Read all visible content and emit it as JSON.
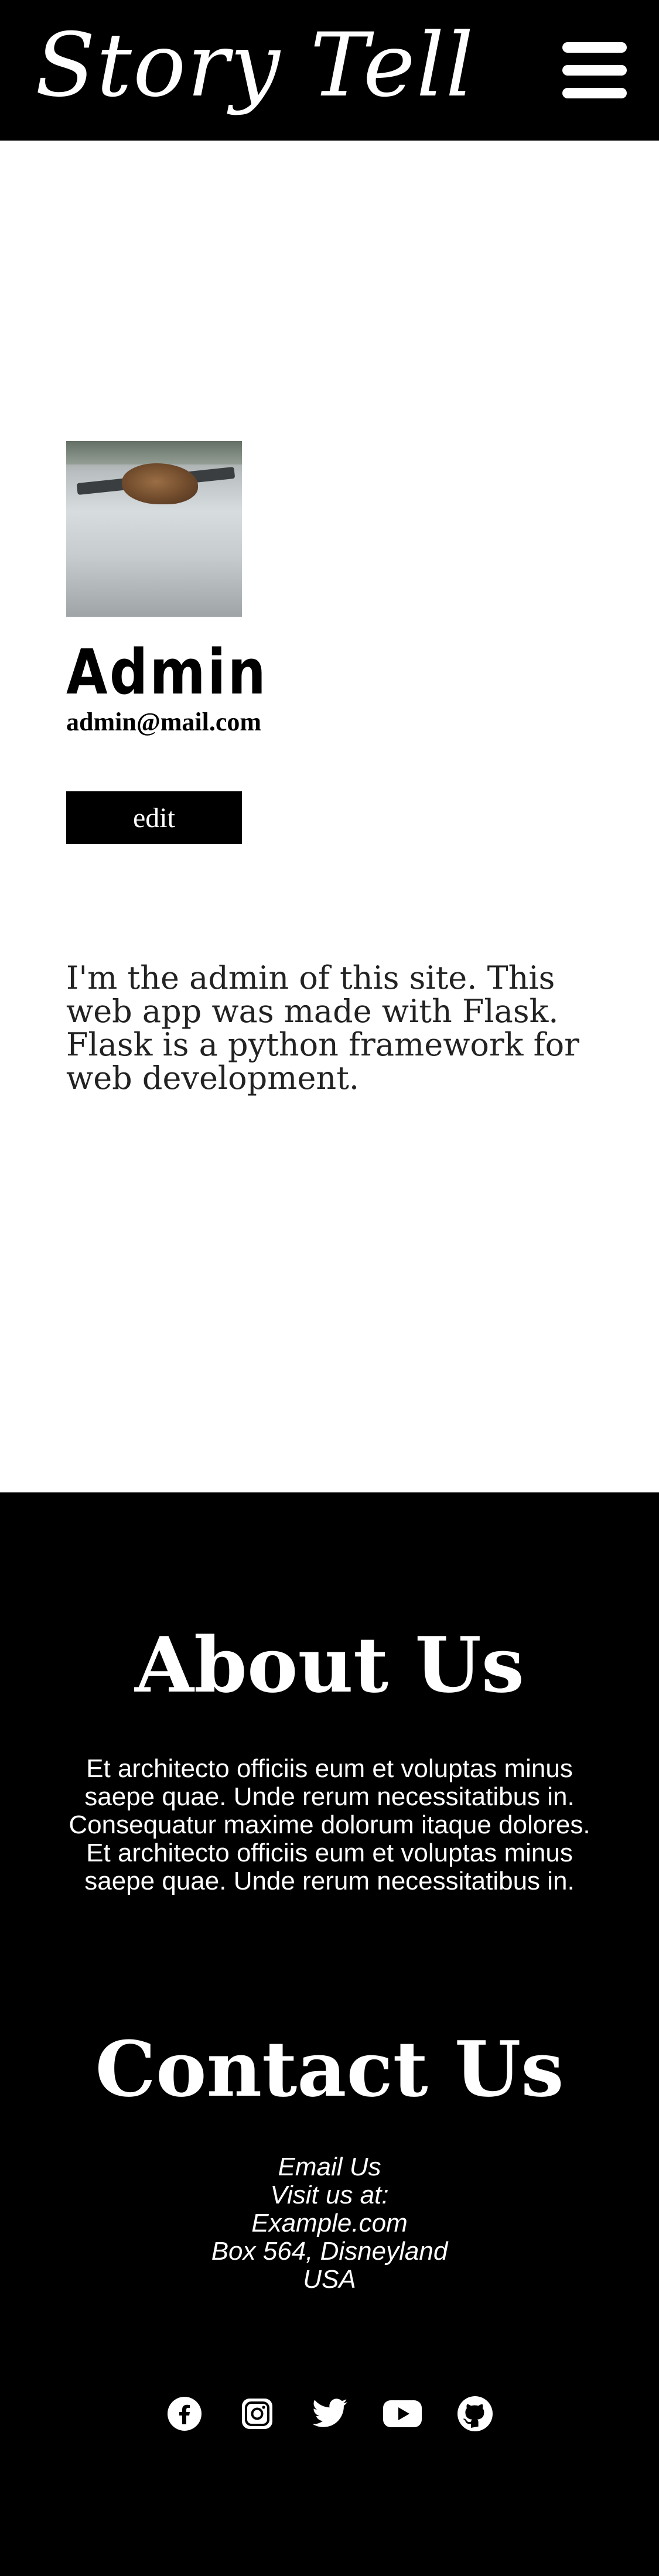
{
  "header": {
    "logo": "Story Tell",
    "menu_icon": "hamburger-menu-icon"
  },
  "profile": {
    "name": "Admin",
    "email": "admin@mail.com",
    "edit_label": "edit",
    "bio": "I'm the admin of this site. This web app was made with Flask. Flask is a python framework for web development."
  },
  "footer": {
    "about_title": "About Us",
    "about_text": "Et architecto officiis eum et voluptas minus saepe quae. Unde rerum necessitatibus in. Consequatur maxime dolorum itaque dolores. Et architecto officiis eum et voluptas minus saepe quae. Unde rerum necessitatibus in.",
    "contact_title": "Contact Us",
    "contact_lines": [
      "Email Us",
      "Visit us at:",
      "Example.com",
      "Box 564, Disneyland",
      "USA"
    ],
    "socials": [
      "facebook-icon",
      "instagram-icon",
      "twitter-icon",
      "youtube-icon",
      "github-icon"
    ]
  },
  "colors": {
    "header_bg": "#000000",
    "footer_bg": "#000000",
    "text_light": "#ffffff"
  }
}
